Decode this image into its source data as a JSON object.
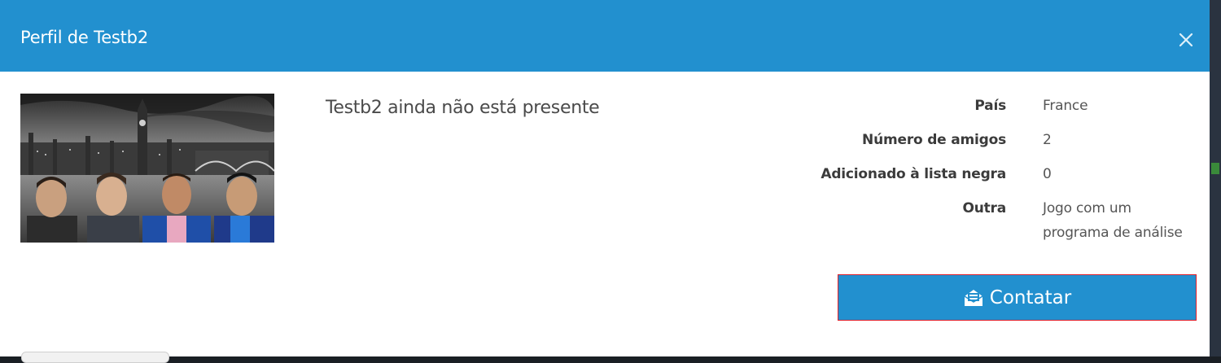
{
  "dialog": {
    "title": "Perfil de Testb2",
    "presence_text": "Testb2 ainda não está presente",
    "close_icon": "close-icon"
  },
  "profile": {
    "fields": [
      {
        "label": "País",
        "value": "France"
      },
      {
        "label": "Número de amigos",
        "value": "2"
      },
      {
        "label": "Adicionado à lista negra",
        "value": "0"
      },
      {
        "label": "Outra",
        "value_line1": "Jogo com um",
        "value_line2": "programa de análise"
      }
    ]
  },
  "actions": {
    "contact_label": "Contatar",
    "contact_icon": "envelope-open-icon"
  },
  "colors": {
    "header": "#2290cf",
    "button": "#2290cf",
    "button_border": "#e0202a"
  }
}
